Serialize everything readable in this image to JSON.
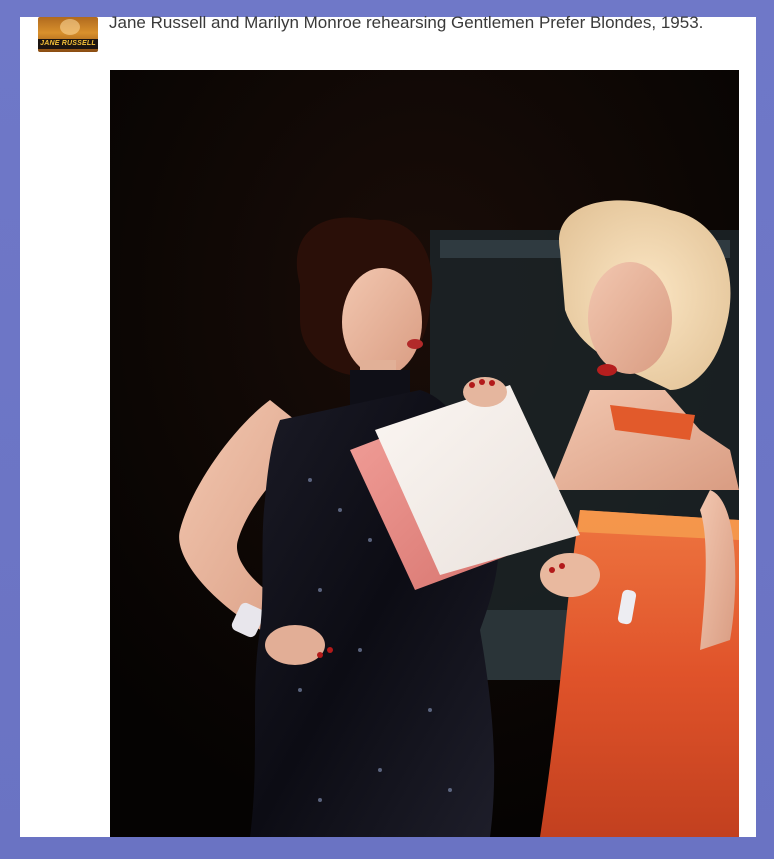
{
  "post": {
    "avatar_label": "JANE RUSSELL",
    "caption": "Jane Russell and Marilyn Monroe rehearsing Gentlemen Prefer Blondes, 1953."
  },
  "photo": {
    "subject": "photo"
  },
  "colors": {
    "frame": "#6b74c4",
    "card": "#ffffff",
    "caption_text": "#3a3a3a",
    "photo_bg": "#0b0604",
    "orange_dress": "#e0532a",
    "black_dress": "#101018"
  }
}
